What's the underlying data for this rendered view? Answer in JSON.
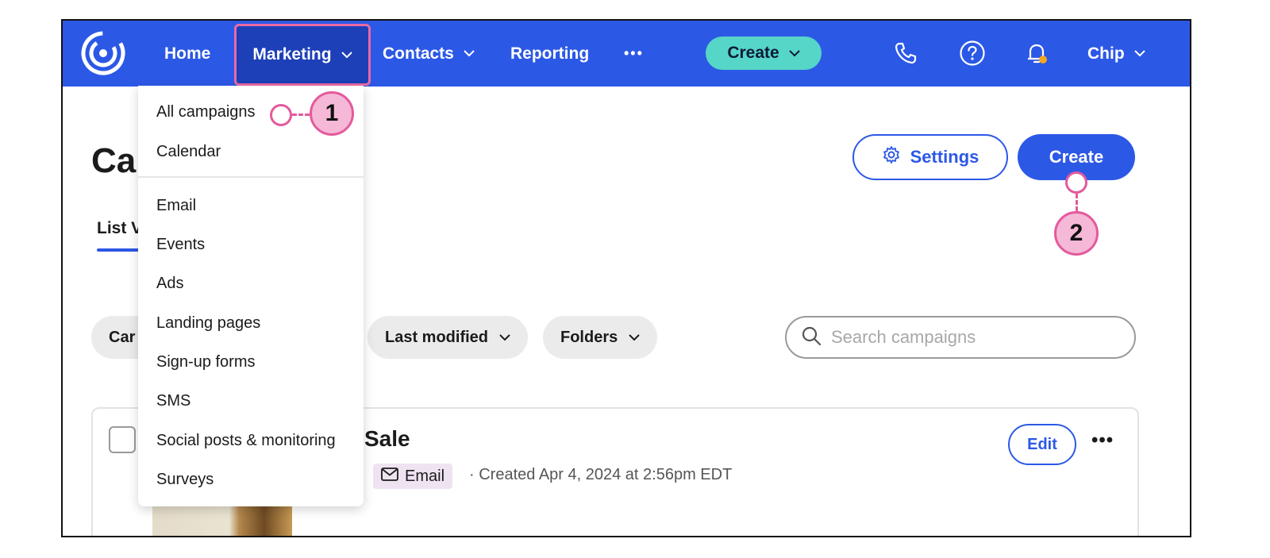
{
  "nav": {
    "home": "Home",
    "marketing": "Marketing",
    "contacts": "Contacts",
    "reporting": "Reporting",
    "more": "•••",
    "create": "Create",
    "user": "Chip",
    "icons": [
      "logo-icon",
      "phone-icon",
      "help-icon",
      "bell-icon"
    ],
    "notification_dot_color": "#f5a623"
  },
  "page": {
    "title": "Ca",
    "tab_list_view": "List V",
    "settings_label": "Settings",
    "create_label": "Create"
  },
  "filters": {
    "campaign_pill": "Car",
    "last_modified": "Last modified",
    "folders": "Folders",
    "search_placeholder": "Search campaigns"
  },
  "campaign": {
    "title": "Sale",
    "type_badge": "Email",
    "created": "· Created Apr 4, 2024 at 2:56pm EDT",
    "edit_label": "Edit",
    "more": "•••"
  },
  "marketing_menu": {
    "items_top": [
      "All campaigns",
      "Calendar"
    ],
    "items_bottom": [
      "Email",
      "Events",
      "Ads",
      "Landing pages",
      "Sign-up forms",
      "SMS",
      "Social posts & monitoring",
      "Surveys"
    ]
  },
  "annotations": {
    "step1": "1",
    "step2": "2",
    "color": "#e35a9c"
  },
  "colors": {
    "brand_blue": "#2c58e6",
    "create_teal": "#55d6c7",
    "highlight_pink": "#e96aa4"
  }
}
